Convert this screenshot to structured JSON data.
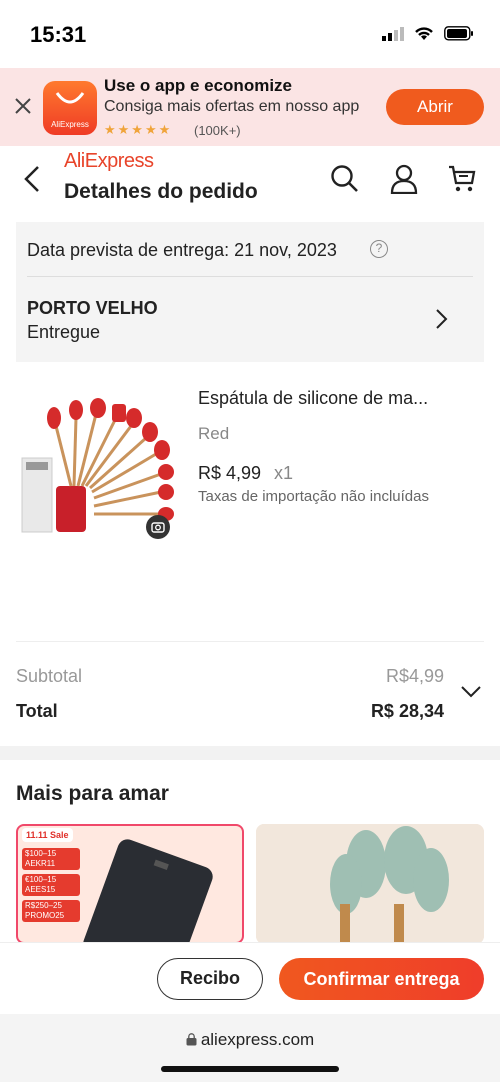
{
  "status_bar": {
    "time": "15:31"
  },
  "banner": {
    "title": "Use o app e economize",
    "subtitle": "Consiga mais ofertas em nosso app",
    "stars": "★★★★★",
    "rating_count": "(100K+)",
    "open_label": "Abrir",
    "logo_text": "AliExpress"
  },
  "header": {
    "brand": "AliExpress",
    "title": "Detalhes do pedido"
  },
  "delivery": {
    "estimate": "Data prevista de entrega: 21 nov, 2023",
    "city": "PORTO VELHO",
    "status": "Entregue"
  },
  "product": {
    "name": "Espátula de silicone de ma...",
    "variant": "Red",
    "price": "R$ 4,99",
    "quantity": "x1",
    "tax_note": "Taxas de importação não incluídas"
  },
  "summary": {
    "subtotal_label": "Subtotal",
    "subtotal_value": "R$4,99",
    "total_label": "Total",
    "total_value": "R$ 28,34"
  },
  "recommendations": {
    "title": "Mais para amar",
    "sale_tag": "11.11 Sale",
    "coupons": [
      {
        "line1": "$100–15",
        "line2": "AEKR11"
      },
      {
        "line1": "€100–15",
        "line2": "AEES15"
      },
      {
        "line1": "R$250–25",
        "line2": "PROMO25"
      }
    ]
  },
  "actions": {
    "receipt_label": "Recibo",
    "confirm_label": "Confirmar entrega"
  },
  "browser": {
    "url": "aliexpress.com"
  },
  "colors": {
    "accent": "#f05b1e",
    "brand": "#e8442a",
    "banner_bg": "#fbe4e4"
  }
}
